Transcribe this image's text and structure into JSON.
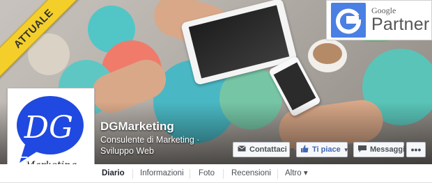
{
  "ribbon": {
    "label": "ATTUALE"
  },
  "partner_badge": {
    "google": "Google",
    "partner": "Partner",
    "icon": "google-g-icon",
    "color": "#4a80e3"
  },
  "profile": {
    "monogram": "DG",
    "caption": "Marketing",
    "bubble_color": "#1f49e0"
  },
  "page": {
    "name": "DGMarketing",
    "category": "Consulente di Marketing · Sviluppo Web"
  },
  "actions": {
    "contact": {
      "label": "Contattaci",
      "icon": "envelope-icon"
    },
    "like": {
      "label": "Ti piace",
      "icon": "thumbs-up-icon"
    },
    "message": {
      "label": "Messaggio",
      "icon": "message-icon"
    },
    "more": {
      "label": "•••"
    }
  },
  "tabs": [
    {
      "label": "Diario",
      "active": true
    },
    {
      "label": "Informazioni"
    },
    {
      "label": "Foto"
    },
    {
      "label": "Recensioni"
    },
    {
      "label": "Altro ▾"
    }
  ],
  "colors": {
    "facebook_blue": "#4267b2",
    "ribbon": "#f4cf2a"
  }
}
